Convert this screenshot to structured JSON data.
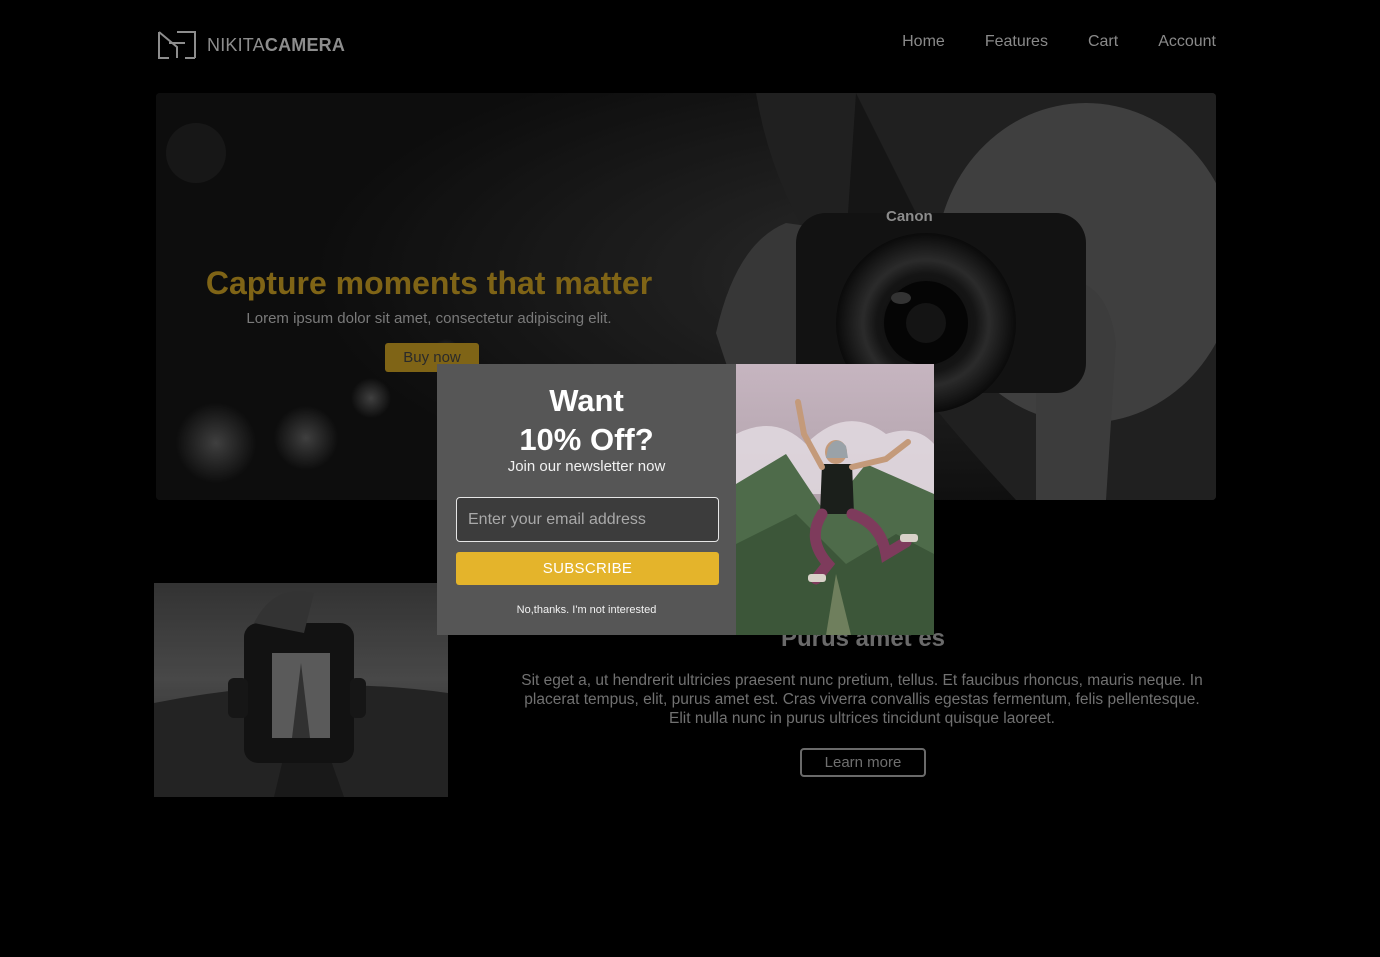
{
  "header": {
    "logo_light": "NIKITA",
    "logo_bold": "CAMERA",
    "nav": [
      "Home",
      "Features",
      "Cart",
      "Account"
    ]
  },
  "hero": {
    "title": "Capture moments that matter",
    "subtitle": "Lorem ipsum dolor sit amet, consectetur adipiscing elit.",
    "button": "Buy now",
    "camera_brand": "Canon"
  },
  "section": {
    "heading": "Purus amet es",
    "body": "Sit eget a, ut hendrerit ultricies praesent nunc pretium, tellus. Et faucibus rhoncus, mauris neque. In placerat tempus, elit, purus amet est. Cras viverra convallis egestas fermentum, felis pellentesque. Elit nulla nunc in purus ultrices tincidunt quisque laoreet.",
    "button": "Learn more"
  },
  "modal": {
    "title_line1": "Want",
    "title_line2": "10% Off?",
    "subtitle": "Join our newsletter now",
    "email_placeholder": "Enter your email address",
    "subscribe": "SUBSCRIBE",
    "decline": "No,thanks. I'm not interested"
  },
  "colors": {
    "accent": "#e4b42b",
    "accent_dimmed": "#7f6416",
    "modal_bg": "#565656",
    "page_bg": "#000000"
  }
}
